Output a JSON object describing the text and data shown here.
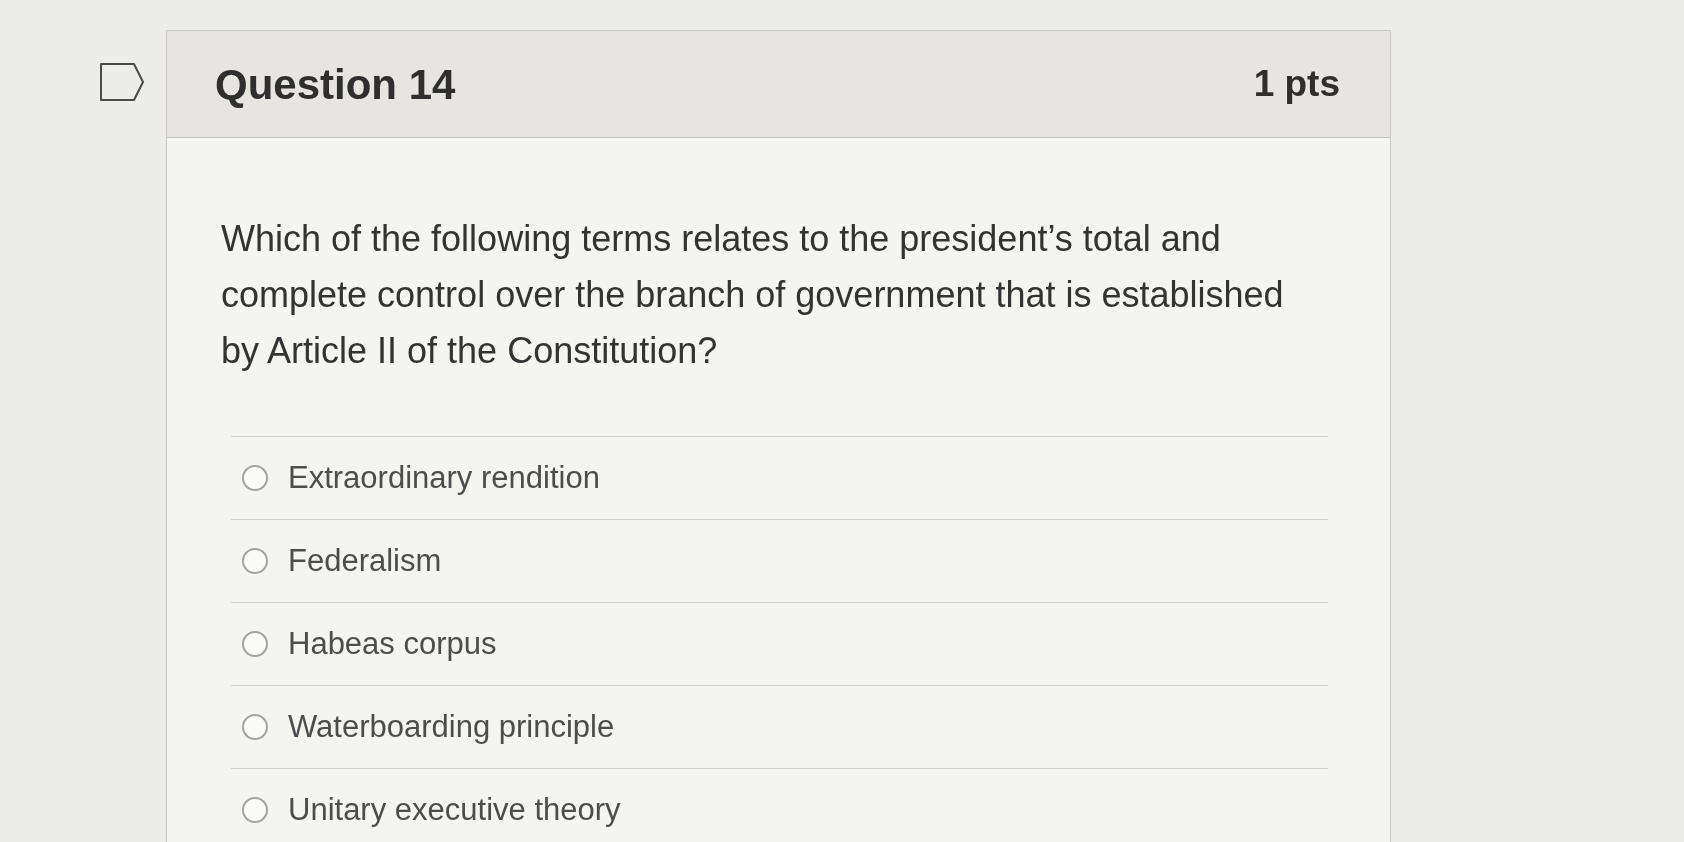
{
  "question": {
    "flagged": false,
    "title": "Question 14",
    "points": "1 pts",
    "text": "Which of the following terms relates to the president’s total and complete control over the branch of government that is established by Article II of the Constitution?"
  },
  "options": [
    {
      "label": "Extraordinary rendition",
      "selected": false
    },
    {
      "label": "Federalism",
      "selected": false
    },
    {
      "label": "Habeas corpus",
      "selected": false
    },
    {
      "label": "Waterboarding principle",
      "selected": false
    },
    {
      "label": "Unitary executive theory",
      "selected": false
    }
  ]
}
